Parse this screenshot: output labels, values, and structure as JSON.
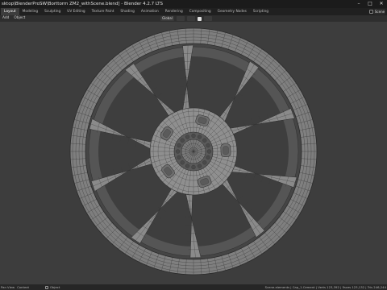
{
  "window": {
    "title": "sktop\\BlenderProSW\\Borttorm ZM2_withScene.blend] - Blender 4.2.7 LTS",
    "controls": [
      "–",
      "□",
      "✕"
    ]
  },
  "workspaces": {
    "tabs": [
      "Layout",
      "Modeling",
      "Sculpting",
      "UV Editing",
      "Texture Paint",
      "Shading",
      "Animation",
      "Rendering",
      "Compositing",
      "Geometry Nodes",
      "Scripting"
    ],
    "active": "Layout",
    "scene_label": "Scene"
  },
  "header": {
    "menus": [
      "Add",
      "Object"
    ],
    "transform_orientation": "Global"
  },
  "statusbar": {
    "left": [
      "Pan View",
      "Context"
    ],
    "mid_label": "Object",
    "stats": "Scene.elements | Cap_1.Cement | Verts 123,392 | Faces 123,132 | Tris 246,244"
  },
  "colors": {
    "background": "#3d3d3d",
    "wire": "#3a3a3a",
    "surface": "#8e8e8e"
  }
}
